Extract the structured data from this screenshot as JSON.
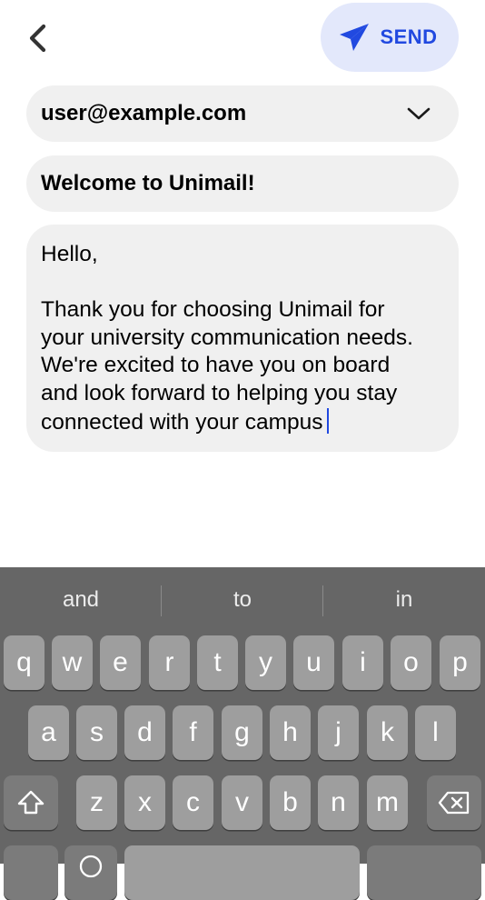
{
  "header": {
    "back_icon": "chevron-left-icon",
    "send_label": "SEND",
    "send_icon": "paper-plane-icon",
    "accent_color": "#2149e0"
  },
  "compose": {
    "from": "user@example.com",
    "subject": "Welcome to Unimail!",
    "body": "Hello,\n\nThank you for choosing Unimail for\nyour university communication needs.\nWe're excited to have you on board\nand look forward to helping you stay\nconnected with your campus"
  },
  "keyboard": {
    "suggestions": [
      "and",
      "to",
      "in"
    ],
    "row1": [
      "q",
      "w",
      "e",
      "r",
      "t",
      "y",
      "u",
      "i",
      "o",
      "p"
    ],
    "row2": [
      "a",
      "s",
      "d",
      "f",
      "g",
      "h",
      "j",
      "k",
      "l"
    ],
    "row3": [
      "z",
      "x",
      "c",
      "v",
      "b",
      "n",
      "m"
    ],
    "shift_icon": "shift-icon",
    "delete_icon": "backspace-icon"
  }
}
